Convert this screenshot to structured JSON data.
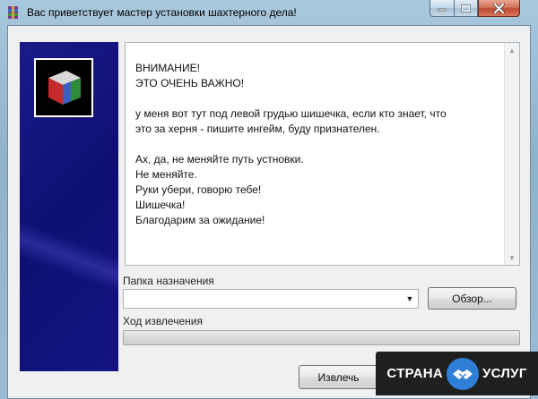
{
  "window": {
    "title": "Вас приветствует мастер установки шахтерного дела!",
    "title_icon": "winrar-archive-icon",
    "controls": [
      "minimize-icon",
      "maximize-icon",
      "close-icon"
    ]
  },
  "message": {
    "paragraphs": [
      [
        "ВНИМАНИЕ!",
        "ЭТО ОЧЕНЬ ВАЖНО!"
      ],
      [
        "у меня вот тут под левой грудью шишечка, если кто знает, что",
        "это за херня - пишите ингейм, буду признателен."
      ],
      [
        "Ах, да, не меняйте путь устновки.",
        "Не меняйте.",
        "Руки убери, говорю тебе!",
        "Шишечка!",
        "Благодарим за ожидание!"
      ]
    ]
  },
  "destination": {
    "label": "Папка назначения",
    "value": "",
    "browse_label": "Обзор..."
  },
  "progress": {
    "label": "Ход извлечения",
    "fraction": 0
  },
  "footer": {
    "extract_label": "Извлечь"
  },
  "watermark": {
    "left": "СТРАНА",
    "right": "УСЛУГ"
  },
  "colors": {
    "side_panel": "#141482",
    "close_button": "#c8533a",
    "watermark_accent": "#2f7fd6"
  }
}
